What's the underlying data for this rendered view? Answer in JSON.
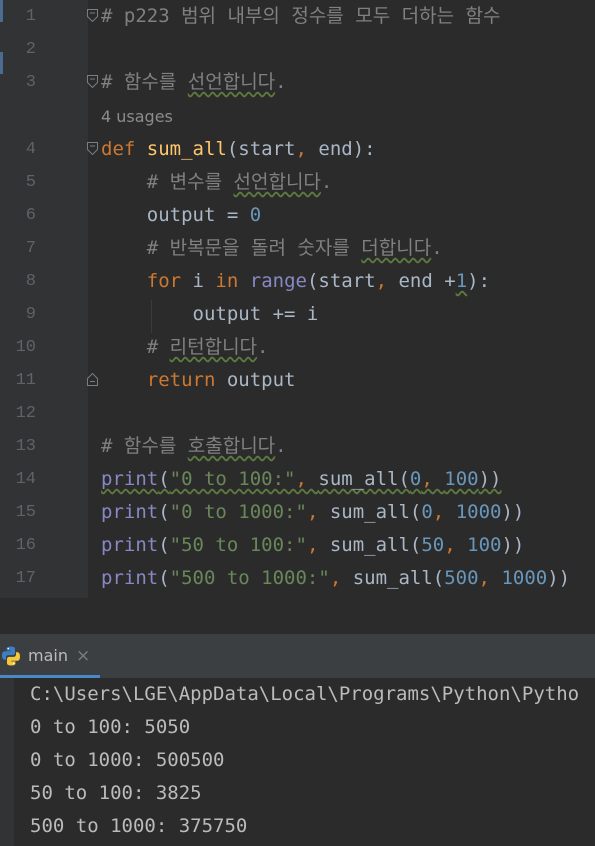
{
  "editor": {
    "usages_hint": "4 usages",
    "lines": [
      {
        "n": "1",
        "tokens": [
          {
            "t": "# p223 범위 내부의 정수를 모두 더하는 함수",
            "c": "cm"
          }
        ]
      },
      {
        "n": "2",
        "tokens": []
      },
      {
        "n": "3",
        "tokens": [
          {
            "t": "# 함수를 ",
            "c": "cm"
          },
          {
            "t": "선언합니다",
            "c": "cm wave"
          },
          {
            "t": ".",
            "c": "cm"
          }
        ]
      },
      {
        "n": "4",
        "tokens": [
          {
            "t": "def ",
            "c": "kw"
          },
          {
            "t": "sum_all",
            "c": "fn"
          },
          {
            "t": "(start",
            "c": ""
          },
          {
            "t": ", ",
            "c": "kw"
          },
          {
            "t": "end):",
            "c": ""
          }
        ]
      },
      {
        "n": "5",
        "tokens": [
          {
            "t": "    # 변수를 ",
            "c": "cm"
          },
          {
            "t": "선언합니다",
            "c": "cm wave"
          },
          {
            "t": ".",
            "c": "cm"
          }
        ]
      },
      {
        "n": "6",
        "tokens": [
          {
            "t": "    output = ",
            "c": ""
          },
          {
            "t": "0",
            "c": "num"
          }
        ]
      },
      {
        "n": "7",
        "tokens": [
          {
            "t": "    # 반복문을 돌려 숫자를 ",
            "c": "cm"
          },
          {
            "t": "더합니다",
            "c": "cm wave"
          },
          {
            "t": ".",
            "c": "cm"
          }
        ]
      },
      {
        "n": "8",
        "tokens": [
          {
            "t": "    ",
            "c": ""
          },
          {
            "t": "for ",
            "c": "kw"
          },
          {
            "t": "i ",
            "c": ""
          },
          {
            "t": "in ",
            "c": "kw"
          },
          {
            "t": "range",
            "c": "bi"
          },
          {
            "t": "(start",
            "c": ""
          },
          {
            "t": ", ",
            "c": "kw"
          },
          {
            "t": "end +",
            "c": ""
          },
          {
            "t": "1",
            "c": "num wave"
          },
          {
            "t": "):",
            "c": ""
          }
        ]
      },
      {
        "n": "9",
        "tokens": [
          {
            "t": "        output += i",
            "c": ""
          }
        ]
      },
      {
        "n": "10",
        "tokens": [
          {
            "t": "    # ",
            "c": "cm"
          },
          {
            "t": "리턴합니다",
            "c": "cm wave"
          },
          {
            "t": ".",
            "c": "cm"
          }
        ]
      },
      {
        "n": "11",
        "tokens": [
          {
            "t": "    ",
            "c": ""
          },
          {
            "t": "return ",
            "c": "kw"
          },
          {
            "t": "output",
            "c": ""
          }
        ]
      },
      {
        "n": "12",
        "tokens": []
      },
      {
        "n": "13",
        "tokens": [
          {
            "t": "# 함수를 ",
            "c": "cm"
          },
          {
            "t": "호출합니다",
            "c": "cm wave"
          },
          {
            "t": ".",
            "c": "cm"
          }
        ]
      },
      {
        "n": "14",
        "tokens": [
          {
            "t": "print",
            "c": "bi wave"
          },
          {
            "t": "(",
            "c": "wave"
          },
          {
            "t": "\"0 to 100:\"",
            "c": "str wave"
          },
          {
            "t": ", ",
            "c": "kw wave"
          },
          {
            "t": "sum_all(",
            "c": "wave"
          },
          {
            "t": "0",
            "c": "num wave"
          },
          {
            "t": ", ",
            "c": "kw wave"
          },
          {
            "t": "100",
            "c": "num wave"
          },
          {
            "t": "))",
            "c": "wave"
          }
        ]
      },
      {
        "n": "15",
        "tokens": [
          {
            "t": "print",
            "c": "bi"
          },
          {
            "t": "(",
            "c": ""
          },
          {
            "t": "\"0 to 1000:\"",
            "c": "str"
          },
          {
            "t": ", ",
            "c": "kw"
          },
          {
            "t": "sum_all(",
            "c": ""
          },
          {
            "t": "0",
            "c": "num"
          },
          {
            "t": ", ",
            "c": "kw"
          },
          {
            "t": "1000",
            "c": "num"
          },
          {
            "t": "))",
            "c": ""
          }
        ]
      },
      {
        "n": "16",
        "tokens": [
          {
            "t": "print",
            "c": "bi"
          },
          {
            "t": "(",
            "c": ""
          },
          {
            "t": "\"50 to 100:\"",
            "c": "str"
          },
          {
            "t": ", ",
            "c": "kw"
          },
          {
            "t": "sum_all(",
            "c": ""
          },
          {
            "t": "50",
            "c": "num"
          },
          {
            "t": ", ",
            "c": "kw"
          },
          {
            "t": "100",
            "c": "num"
          },
          {
            "t": "))",
            "c": ""
          }
        ]
      },
      {
        "n": "17",
        "tokens": [
          {
            "t": "print",
            "c": "bi"
          },
          {
            "t": "(",
            "c": ""
          },
          {
            "t": "\"500 to 1000:\"",
            "c": "str"
          },
          {
            "t": ", ",
            "c": "kw"
          },
          {
            "t": "sum_all(",
            "c": ""
          },
          {
            "t": "500",
            "c": "num"
          },
          {
            "t": ", ",
            "c": "kw"
          },
          {
            "t": "1000",
            "c": "num"
          },
          {
            "t": "))",
            "c": ""
          }
        ]
      }
    ]
  },
  "run_panel": {
    "tab_label": "main",
    "close_glyph": "×",
    "output": [
      "C:\\Users\\LGE\\AppData\\Local\\Programs\\Python\\Pytho",
      "0 to 100: 5050",
      "0 to 1000: 500500",
      "50 to 100: 3825",
      "500 to 1000: 375750"
    ]
  },
  "colors": {
    "background": "#2b2b2b",
    "keyword": "#cc7832",
    "function": "#ffc66d",
    "comment": "#808080",
    "number": "#6897bb",
    "string": "#6a8759",
    "builtin": "#8888c6",
    "default_text": "#a9b7c6"
  }
}
